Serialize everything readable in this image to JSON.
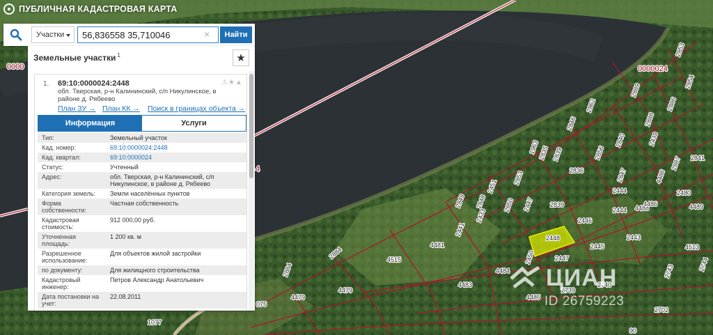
{
  "header": {
    "title": "ПУБЛИЧНАЯ КАДАСТРОВАЯ КАРТА"
  },
  "search": {
    "type_label": "Участки",
    "query": "56,836558 35,710046",
    "find_label": "Найти"
  },
  "panel": {
    "title": "Земельные участки",
    "count": "1"
  },
  "result": {
    "number": "1.",
    "cad_number": "69:10:0000024:2448",
    "address_short": "обл. Тверская, р-н Калининский, с/п Никулинское, в районе д. Рябеево",
    "links": [
      "План ЗУ →",
      "План КК →",
      "Поиск в границах объекта →"
    ],
    "tabs": [
      "Информация",
      "Услуги"
    ]
  },
  "info_rows": [
    {
      "k": "Тип:",
      "v": "Земельный участок"
    },
    {
      "k": "Кад. номер:",
      "v": "69:10:0000024:2448"
    },
    {
      "k": "Кад. квартал:",
      "v": "69:10:0000024"
    },
    {
      "k": "Статус:",
      "v": "Учтенный"
    },
    {
      "k": "Адрес:",
      "v": "обл. Тверская, р-н Калининский, с/п Никулинское, в районе д. Рябеево"
    },
    {
      "k": "Категория земель:",
      "v": "Земли населённых пунктов"
    },
    {
      "k": "Форма собственности:",
      "v": "Частная собственность"
    },
    {
      "k": "Кадастровая стоимость:",
      "v": "912 000,00 руб."
    },
    {
      "k": "Уточненная площадь:",
      "v": "1 200 кв. м"
    },
    {
      "k": "Разрешенное использование:",
      "v": "Для объектов жилой застройки"
    },
    {
      "k": "по документу:",
      "v": "Для жилищного строительства"
    },
    {
      "k": "Кадастровый инженер:",
      "v": "Петров Александр Анатольевич"
    },
    {
      "k": "Дата постановки на учет:",
      "v": "22.08.2011"
    }
  ],
  "map": {
    "quarter_labels": [
      "0000024",
      "0000",
      "4"
    ],
    "plot_labels": [
      "2853",
      "2854",
      "2889",
      "2888",
      "2886",
      "2862",
      "2846",
      "2840",
      "2839",
      "2835",
      "2836",
      "1963",
      "2856",
      "2847",
      "2841",
      "2439",
      "2887",
      "4486",
      "2480",
      "2451",
      "2849",
      "2853",
      "2848",
      "2850",
      "2447",
      "2839",
      "2444",
      "4489",
      "4488",
      "2444",
      "4486",
      "2446",
      "2441",
      "2433",
      "2448",
      "2445",
      "2443",
      "4481",
      "4483",
      "2447",
      "4513",
      "4515",
      "2884",
      "4484",
      "4479",
      "2450",
      "2884",
      "2739",
      "2740",
      "2743",
      "4485",
      "2744",
      "4479",
      "2702",
      "1077",
      "90",
      "075"
    ],
    "highlight_plot": "2448"
  },
  "watermark": {
    "brand": "ЦИАН",
    "id": "ID 26759223"
  },
  "colors": {
    "accent": "#1f6fb5",
    "parcel_border": "#b0142a",
    "highlight": "#d8e600",
    "water": "#2c3136"
  }
}
